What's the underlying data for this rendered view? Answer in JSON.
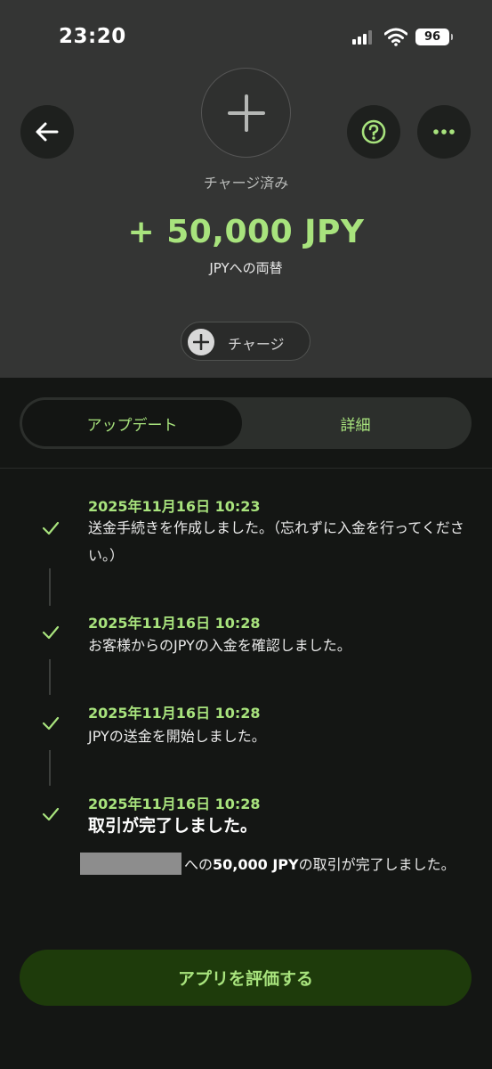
{
  "status_bar": {
    "time": "23:20",
    "battery": "96"
  },
  "header": {
    "status_label": "チャージ済み",
    "amount": "+ 50,000 JPY",
    "subline": "JPYへの両替",
    "charge_button_label": "チャージ"
  },
  "tabs": [
    {
      "label": "アップデート",
      "active": true
    },
    {
      "label": "詳細",
      "active": false
    }
  ],
  "events": [
    {
      "date": "2025年11月16日 10:23",
      "text": "送金手続きを作成しました。（忘れずに入金を行ってください。）"
    },
    {
      "date": "2025年11月16日 10:28",
      "text": "お客様からのJPYの入金を確認しました。"
    },
    {
      "date": "2025年11月16日 10:28",
      "text": "JPYの送金を開始しました。"
    },
    {
      "date": "2025年11月16日 10:28",
      "text": "取引が完了しました。",
      "detail_prefix": "への",
      "detail_amount": "50,000 JPY",
      "detail_suffix": "の取引が完了しました。"
    }
  ],
  "rate_button_label": "アプリを評価する",
  "colors": {
    "accent": "#a8e37d",
    "header_bg": "#343534",
    "body_bg": "#141614",
    "rate_button_bg": "#1e3b0b"
  },
  "icons": [
    "back-arrow-icon",
    "plus-icon",
    "help-icon",
    "more-icon",
    "check-icon",
    "signal-icon",
    "wifi-icon"
  ]
}
